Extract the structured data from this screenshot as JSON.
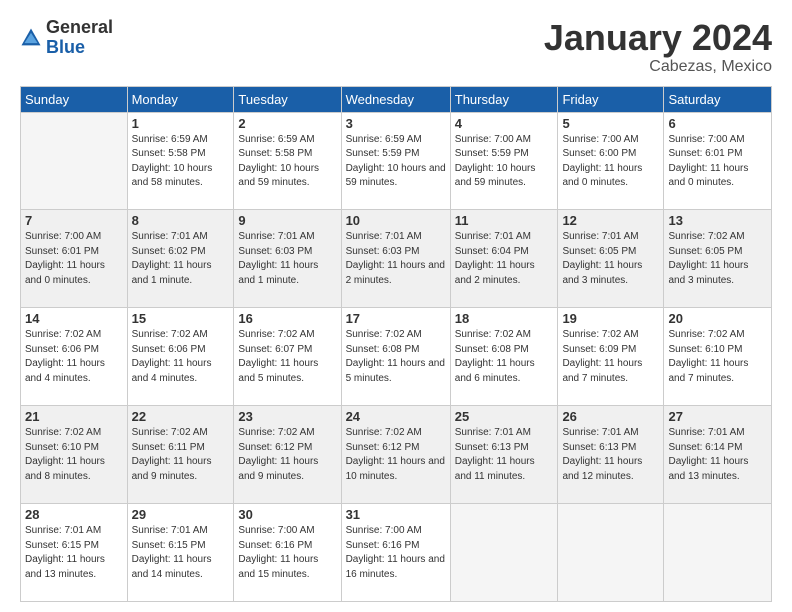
{
  "logo": {
    "general": "General",
    "blue": "Blue"
  },
  "header": {
    "month": "January 2024",
    "location": "Cabezas, Mexico"
  },
  "weekdays": [
    "Sunday",
    "Monday",
    "Tuesday",
    "Wednesday",
    "Thursday",
    "Friday",
    "Saturday"
  ],
  "weeks": [
    [
      {
        "day": "",
        "empty": true
      },
      {
        "day": "1",
        "rise": "6:59 AM",
        "set": "5:58 PM",
        "daylight": "10 hours and 58 minutes."
      },
      {
        "day": "2",
        "rise": "6:59 AM",
        "set": "5:58 PM",
        "daylight": "10 hours and 59 minutes."
      },
      {
        "day": "3",
        "rise": "6:59 AM",
        "set": "5:59 PM",
        "daylight": "10 hours and 59 minutes."
      },
      {
        "day": "4",
        "rise": "7:00 AM",
        "set": "5:59 PM",
        "daylight": "10 hours and 59 minutes."
      },
      {
        "day": "5",
        "rise": "7:00 AM",
        "set": "6:00 PM",
        "daylight": "11 hours and 0 minutes."
      },
      {
        "day": "6",
        "rise": "7:00 AM",
        "set": "6:01 PM",
        "daylight": "11 hours and 0 minutes."
      }
    ],
    [
      {
        "day": "7",
        "rise": "7:00 AM",
        "set": "6:01 PM",
        "daylight": "11 hours and 0 minutes."
      },
      {
        "day": "8",
        "rise": "7:01 AM",
        "set": "6:02 PM",
        "daylight": "11 hours and 1 minute."
      },
      {
        "day": "9",
        "rise": "7:01 AM",
        "set": "6:03 PM",
        "daylight": "11 hours and 1 minute."
      },
      {
        "day": "10",
        "rise": "7:01 AM",
        "set": "6:03 PM",
        "daylight": "11 hours and 2 minutes."
      },
      {
        "day": "11",
        "rise": "7:01 AM",
        "set": "6:04 PM",
        "daylight": "11 hours and 2 minutes."
      },
      {
        "day": "12",
        "rise": "7:01 AM",
        "set": "6:05 PM",
        "daylight": "11 hours and 3 minutes."
      },
      {
        "day": "13",
        "rise": "7:02 AM",
        "set": "6:05 PM",
        "daylight": "11 hours and 3 minutes."
      }
    ],
    [
      {
        "day": "14",
        "rise": "7:02 AM",
        "set": "6:06 PM",
        "daylight": "11 hours and 4 minutes."
      },
      {
        "day": "15",
        "rise": "7:02 AM",
        "set": "6:06 PM",
        "daylight": "11 hours and 4 minutes."
      },
      {
        "day": "16",
        "rise": "7:02 AM",
        "set": "6:07 PM",
        "daylight": "11 hours and 5 minutes."
      },
      {
        "day": "17",
        "rise": "7:02 AM",
        "set": "6:08 PM",
        "daylight": "11 hours and 5 minutes."
      },
      {
        "day": "18",
        "rise": "7:02 AM",
        "set": "6:08 PM",
        "daylight": "11 hours and 6 minutes."
      },
      {
        "day": "19",
        "rise": "7:02 AM",
        "set": "6:09 PM",
        "daylight": "11 hours and 7 minutes."
      },
      {
        "day": "20",
        "rise": "7:02 AM",
        "set": "6:10 PM",
        "daylight": "11 hours and 7 minutes."
      }
    ],
    [
      {
        "day": "21",
        "rise": "7:02 AM",
        "set": "6:10 PM",
        "daylight": "11 hours and 8 minutes."
      },
      {
        "day": "22",
        "rise": "7:02 AM",
        "set": "6:11 PM",
        "daylight": "11 hours and 9 minutes."
      },
      {
        "day": "23",
        "rise": "7:02 AM",
        "set": "6:12 PM",
        "daylight": "11 hours and 9 minutes."
      },
      {
        "day": "24",
        "rise": "7:02 AM",
        "set": "6:12 PM",
        "daylight": "11 hours and 10 minutes."
      },
      {
        "day": "25",
        "rise": "7:01 AM",
        "set": "6:13 PM",
        "daylight": "11 hours and 11 minutes."
      },
      {
        "day": "26",
        "rise": "7:01 AM",
        "set": "6:13 PM",
        "daylight": "11 hours and 12 minutes."
      },
      {
        "day": "27",
        "rise": "7:01 AM",
        "set": "6:14 PM",
        "daylight": "11 hours and 13 minutes."
      }
    ],
    [
      {
        "day": "28",
        "rise": "7:01 AM",
        "set": "6:15 PM",
        "daylight": "11 hours and 13 minutes."
      },
      {
        "day": "29",
        "rise": "7:01 AM",
        "set": "6:15 PM",
        "daylight": "11 hours and 14 minutes."
      },
      {
        "day": "30",
        "rise": "7:00 AM",
        "set": "6:16 PM",
        "daylight": "11 hours and 15 minutes."
      },
      {
        "day": "31",
        "rise": "7:00 AM",
        "set": "6:16 PM",
        "daylight": "11 hours and 16 minutes."
      },
      {
        "day": "",
        "empty": true
      },
      {
        "day": "",
        "empty": true
      },
      {
        "day": "",
        "empty": true
      }
    ]
  ]
}
